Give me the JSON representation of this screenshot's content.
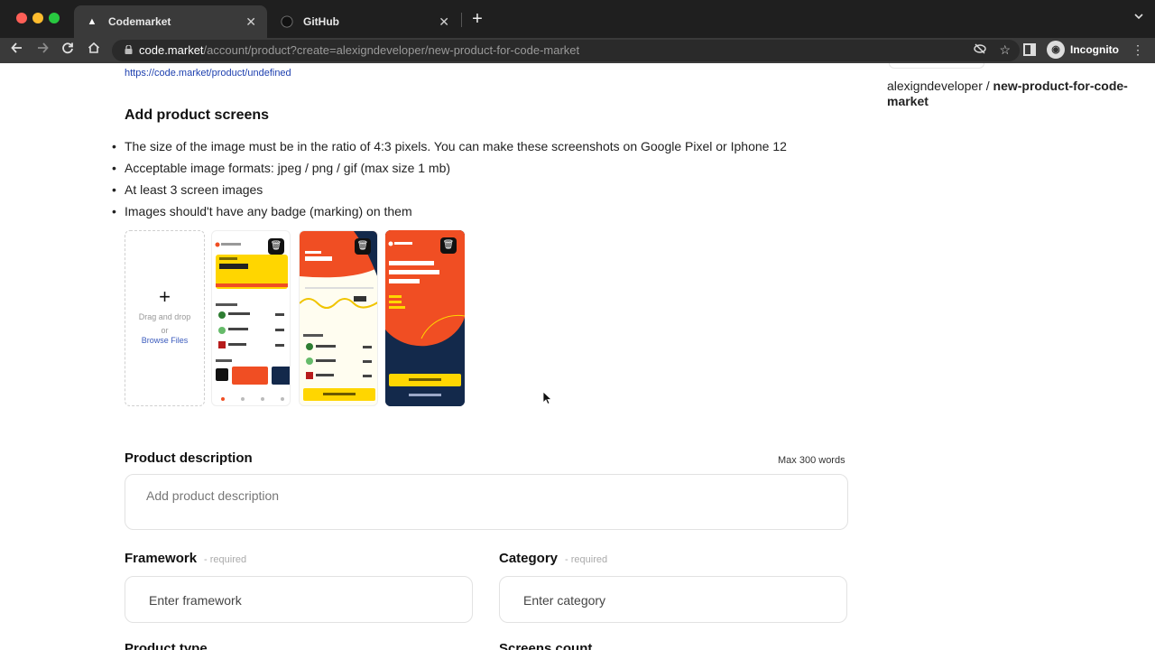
{
  "browser": {
    "tabs": [
      {
        "label": "Codemarket",
        "close": "✕"
      },
      {
        "label": "GitHub",
        "close": "✕"
      }
    ],
    "new_tab": "+",
    "url_host": "code.market",
    "url_path": "/account/product?create=alexigndeveloper/new-product-for-code-market",
    "profile_label": "Incognito"
  },
  "page": {
    "product_link": "https://code.market/product/undefined",
    "screens_title": "Add product screens",
    "rules": [
      "The size of the image must be in the ratio of 4:3 pixels. You can make these screenshots on Google Pixel or Iphone 12",
      "Acceptable image formats: jpeg / png / gif (max size 1 mb)",
      "At least 3 screen images",
      "Images should't have any badge (marking) on them"
    ],
    "dropzone": {
      "plus": "+",
      "line1": "Drag and drop",
      "line2": "or",
      "browse": "Browse Files"
    },
    "thumbnails": [
      {
        "app": "Bank App",
        "heading": "Total Balance",
        "amount": "$17,982.22",
        "section": "Transactions",
        "button": ""
      },
      {
        "app": "",
        "heading": "Total Balance",
        "amount": "$4,661.91",
        "section": "Transactions",
        "button": "Order a new card"
      },
      {
        "app": "Bank App",
        "heading": "Create Bank account in 3 minutes",
        "amount": "",
        "section": "Easy. Fast. Secure.",
        "button": "Create Account",
        "footer": "Already Member?"
      }
    ],
    "description": {
      "title": "Product description",
      "max": "Max 300 words",
      "placeholder": "Add product description"
    },
    "framework": {
      "title": "Framework",
      "req": "- required",
      "placeholder": "Enter framework"
    },
    "category": {
      "title": "Category",
      "req": "- required",
      "placeholder": "Enter category"
    },
    "cut_left": "Product type",
    "cut_right": "Screens count",
    "repo_owner": "alexigndeveloper /",
    "repo_name": "new-product-for-code-market"
  },
  "colors": {
    "accent_orange": "#f04e23",
    "accent_yellow": "#ffd600",
    "navy": "#13294b",
    "link_blue": "#1e40af"
  }
}
